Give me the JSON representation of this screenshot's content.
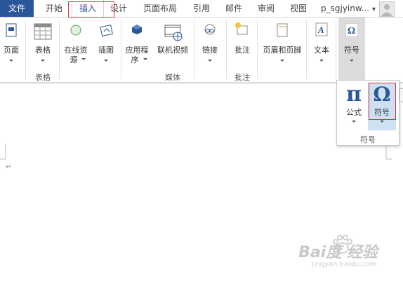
{
  "tabs": [
    {
      "label": "文件",
      "id": "file"
    },
    {
      "label": "开始",
      "id": "home"
    },
    {
      "label": "插入",
      "id": "insert"
    },
    {
      "label": "设计",
      "id": "design"
    },
    {
      "label": "页面布局",
      "id": "layout"
    },
    {
      "label": "引用",
      "id": "references"
    },
    {
      "label": "邮件",
      "id": "mailings"
    },
    {
      "label": "审阅",
      "id": "review"
    },
    {
      "label": "视图",
      "id": "view"
    }
  ],
  "user": {
    "name": "p_sgjyinw...",
    "dropdown": "▾"
  },
  "ribbon": {
    "pages": {
      "label": "页面",
      "icon": "page-icon"
    },
    "table": {
      "label": "表格",
      "icon": "table-icon",
      "group": "表格"
    },
    "online_resources": {
      "line1": "在线资",
      "line2": "源",
      "icon": "online-resource-icon"
    },
    "illustrations": {
      "label": "插图",
      "icon": "illustration-icon"
    },
    "apps": {
      "line1": "应用程",
      "line2": "序",
      "icon": "app-icon"
    },
    "online_video": {
      "label": "联机视频",
      "icon": "online-video-icon",
      "group": "媒体"
    },
    "links": {
      "label": "链接",
      "icon": "link-icon"
    },
    "comment": {
      "label": "批注",
      "icon": "comment-icon",
      "group": "批注"
    },
    "header_footer": {
      "label": "页眉和页脚",
      "icon": "header-footer-icon"
    },
    "text": {
      "label": "文本",
      "icon": "text-icon"
    },
    "symbols": {
      "label": "符号",
      "icon": "omega-icon"
    }
  },
  "popup": {
    "equation": {
      "label": "公式",
      "glyph": "π"
    },
    "symbol": {
      "label": "符号",
      "glyph": "Ω"
    },
    "group": "符号"
  },
  "document": {
    "paragraph_mark": "↵"
  },
  "watermark": {
    "brand": "Bai度 经验",
    "url": "jingyan.baidu.com"
  },
  "colors": {
    "file_tab": "#2b579a",
    "highlight_box": "#e0343a",
    "symbol_blue": "#2b579a",
    "hover_blue": "#cde1f3"
  }
}
